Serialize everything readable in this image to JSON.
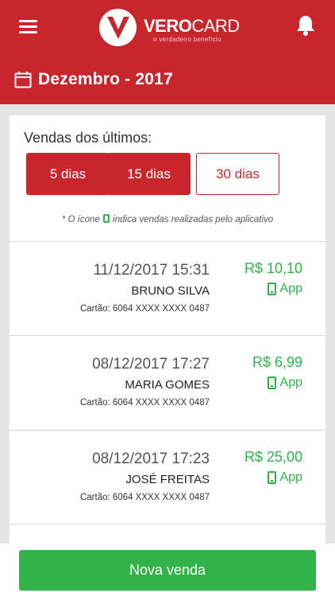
{
  "header": {
    "logo_bold": "VERO",
    "logo_thin": "CARD",
    "logo_tagline": "o verdadeiro benefício",
    "month": "Dezembro - 2017",
    "icons": {
      "menu": "hamburger-menu-icon",
      "notifications": "bell-icon",
      "calendar": "calendar-icon"
    },
    "colors": {
      "brand": "#c8262d",
      "accent_green": "#32b34a"
    }
  },
  "filter": {
    "label": "Vendas dos últimos:",
    "options": [
      {
        "label": "5 dias",
        "style": "solid"
      },
      {
        "label": "15 dias",
        "style": "solid"
      },
      {
        "label": "30 dias",
        "style": "outline"
      }
    ]
  },
  "note": {
    "prefix": "* O ícone",
    "suffix": "indica vendas realizadas pelo aplicativo"
  },
  "sales": [
    {
      "datetime": "11/12/2017 15:31",
      "name": "BRUNO SILVA",
      "card": "Cartão: 6064 XXXX XXXX 0487",
      "amount": "R$ 10,10",
      "channel": "App"
    },
    {
      "datetime": "08/12/2017 17:27",
      "name": "MARIA GOMES",
      "card": "Cartão: 6064 XXXX XXXX 0487",
      "amount": "R$ 6,99",
      "channel": "App"
    },
    {
      "datetime": "08/12/2017 17:23",
      "name": "JOSÉ FREITAS",
      "card": "Cartão: 6064 XXXX XXXX 0487",
      "amount": "R$ 25,00",
      "channel": "App"
    }
  ],
  "actions": {
    "new_sale": "Nova venda"
  }
}
